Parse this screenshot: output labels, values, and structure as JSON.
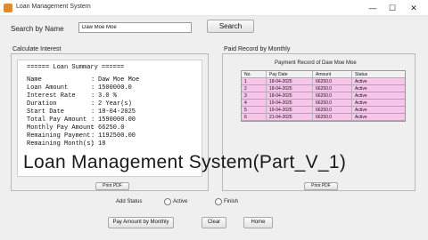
{
  "window": {
    "title": "Loan Management System",
    "controls": {
      "minimize": "—",
      "maximize": "☐",
      "close": "✕"
    }
  },
  "search": {
    "label": "Search by Name",
    "value": "Daw Moe Moe",
    "button": "Search"
  },
  "calculate": {
    "title": "Calculate Interest",
    "summary_header": "====== Loan Summary ======",
    "rows": [
      {
        "label": "Name",
        "value": "Daw Moe Moe"
      },
      {
        "label": "Loan Amount",
        "value": "1500000.0"
      },
      {
        "label": "Interest Rate",
        "value": "3.0 %"
      },
      {
        "label": "Duration",
        "value": "2 Year(s)"
      },
      {
        "label": "Start Date",
        "value": "18-04-2025"
      },
      {
        "label": "Total Pay Amount",
        "value": "1590000.00"
      },
      {
        "label": "Monthly Pay Amount",
        "value": "66250.0"
      },
      {
        "label": "Remaining Payment",
        "value": "1192500.00"
      },
      {
        "label": "Remaining Month(s)",
        "value": "18"
      }
    ],
    "separator": ":",
    "print_button": "Print PDF"
  },
  "paid": {
    "title": "Paid Record by Monthly",
    "caption": "Payment Record of Daw Moe Moe",
    "columns": [
      "No.",
      "Pay Date",
      "Amount",
      "Status"
    ],
    "rows": [
      [
        "1",
        "18-04-2025",
        "66250.0",
        "Active"
      ],
      [
        "2",
        "18-04-2025",
        "66250.0",
        "Active"
      ],
      [
        "3",
        "18-04-2025",
        "66250.0",
        "Active"
      ],
      [
        "4",
        "19-04-2025",
        "66250.0",
        "Active"
      ],
      [
        "5",
        "19-04-2025",
        "66250.0",
        "Active"
      ],
      [
        "6",
        "21-04-2025",
        "66250.0",
        "Active"
      ]
    ],
    "print_button": "Print PDF"
  },
  "overlay_title": "Loan  Management  System(Part_V_1)",
  "status": {
    "label": "Add Status",
    "options": [
      "Active",
      "Finish"
    ]
  },
  "buttons": {
    "pay": "Pay Amount by Monthly",
    "clear": "Clear",
    "home": "Home"
  },
  "colors": {
    "row_highlight": "#f6c5ea",
    "window_bg": "#efefef"
  }
}
